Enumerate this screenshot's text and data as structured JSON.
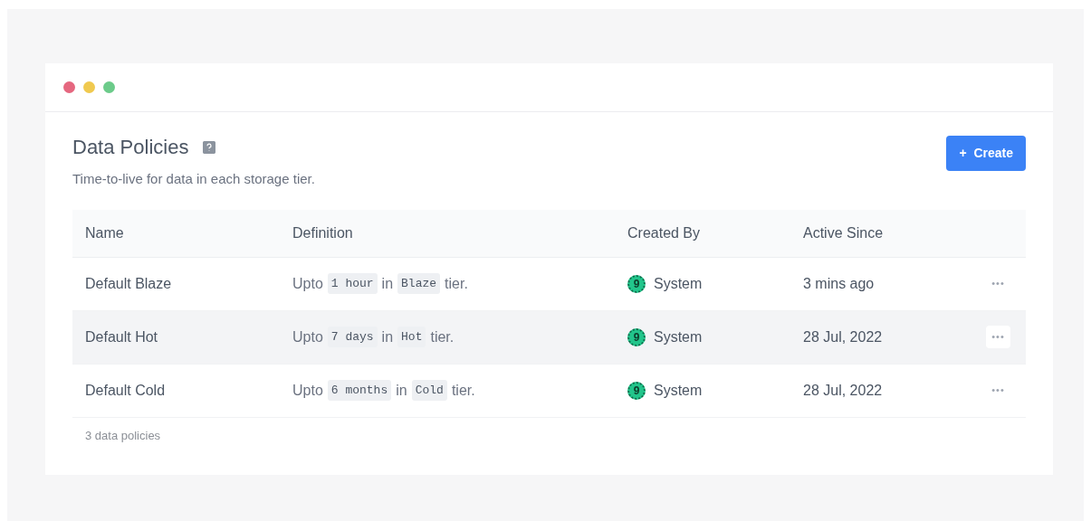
{
  "window": {
    "controls": [
      {
        "color": "#e5677f"
      },
      {
        "color": "#f0c94f"
      },
      {
        "color": "#6ccb8a"
      }
    ]
  },
  "header": {
    "title": "Data Policies",
    "subtitle": "Time-to-live for data in each storage tier.",
    "create_button": {
      "icon": "+",
      "label": "Create"
    }
  },
  "table": {
    "columns": [
      "Name",
      "Definition",
      "Created By",
      "Active Since"
    ],
    "rows": [
      {
        "name": "Default Blaze",
        "definition": {
          "prefix": "Upto",
          "duration": "1 hour",
          "joiner": "in",
          "tier": "Blaze",
          "suffix": "tier."
        },
        "created_by": {
          "avatar": "9",
          "name": "System"
        },
        "active_since": "3 mins ago",
        "menu": "•••",
        "hovered": false
      },
      {
        "name": "Default Hot",
        "definition": {
          "prefix": "Upto",
          "duration": "7 days",
          "joiner": "in",
          "tier": "Hot",
          "suffix": "tier."
        },
        "created_by": {
          "avatar": "9",
          "name": "System"
        },
        "active_since": "28 Jul, 2022",
        "menu": "•••",
        "hovered": true
      },
      {
        "name": "Default Cold",
        "definition": {
          "prefix": "Upto",
          "duration": "6 months",
          "joiner": "in",
          "tier": "Cold",
          "suffix": "tier."
        },
        "created_by": {
          "avatar": "9",
          "name": "System"
        },
        "active_since": "28 Jul, 2022",
        "menu": "•••",
        "hovered": false
      }
    ],
    "footer": "3 data policies"
  }
}
